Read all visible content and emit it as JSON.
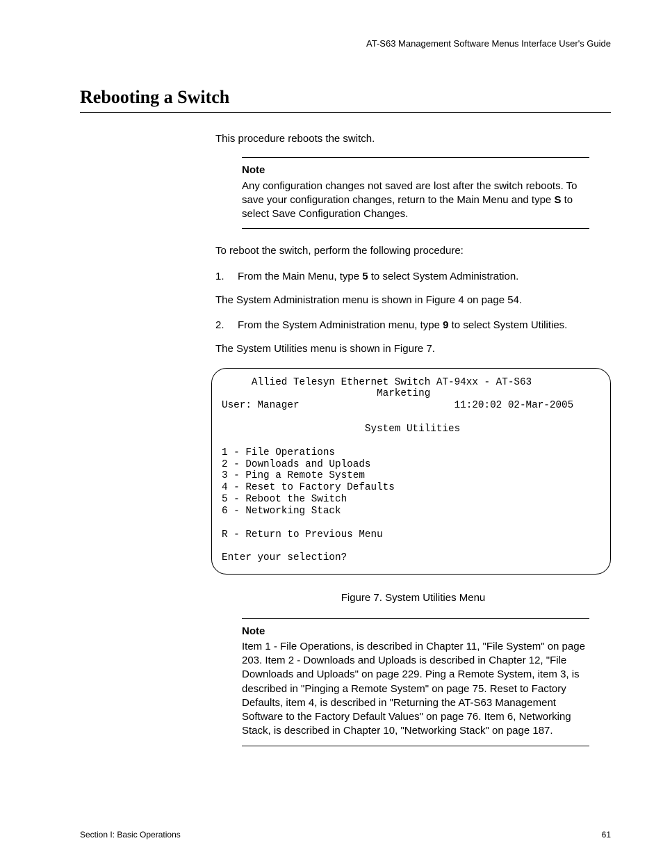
{
  "header": {
    "running_head": "AT-S63 Management Software Menus Interface User's Guide"
  },
  "title": "Rebooting a Switch",
  "intro": "This procedure reboots the switch.",
  "note1": {
    "label": "Note",
    "text_before_bold": "Any configuration changes not saved are lost after the switch reboots. To save your configuration changes, return to the Main Menu and type ",
    "bold": "S",
    "text_after_bold": " to select Save Configuration Changes."
  },
  "lead_in": "To reboot the switch, perform the following procedure:",
  "steps": {
    "s1": {
      "num": "1.",
      "before": "From the Main Menu, type ",
      "bold": "5",
      "after": " to select System Administration.",
      "sub": "The System Administration menu is shown in Figure 4 on page 54."
    },
    "s2": {
      "num": "2.",
      "before": "From the System Administration menu, type ",
      "bold": "9",
      "after": " to select System Utilities.",
      "sub": "The System Utilities menu is shown in Figure 7."
    }
  },
  "terminal": {
    "line_title": "     Allied Telesyn Ethernet Switch AT-94xx - AT-S63",
    "line_sub": "                          Marketing",
    "line_user": "User: Manager                          11:20:02 02-Mar-2005",
    "line_blank1": "",
    "line_heading": "                        System Utilities",
    "line_blank2": "",
    "opt1": "1 - File Operations",
    "opt2": "2 - Downloads and Uploads",
    "opt3": "3 - Ping a Remote System",
    "opt4": "4 - Reset to Factory Defaults",
    "opt5": "5 - Reboot the Switch",
    "opt6": "6 - Networking Stack",
    "line_blank3": "",
    "optR": "R - Return to Previous Menu",
    "line_blank4": "",
    "prompt": "Enter your selection?"
  },
  "figure_caption": "Figure 7. System Utilities Menu",
  "note2": {
    "label": "Note",
    "text": "Item 1 - File Operations, is described in Chapter 11, \"File System\" on page 203. Item 2 - Downloads and Uploads is described in Chapter 12, \"File Downloads and Uploads\" on page 229. Ping a Remote System, item 3, is described in \"Pinging a Remote System\" on page 75. Reset to Factory Defaults, item 4, is described in \"Returning the AT-S63 Management Software to the Factory Default Values\" on page 76. Item 6, Networking Stack, is described in Chapter 10, \"Networking Stack\" on page 187."
  },
  "footer": {
    "section": "Section I: Basic Operations",
    "page": "61"
  }
}
